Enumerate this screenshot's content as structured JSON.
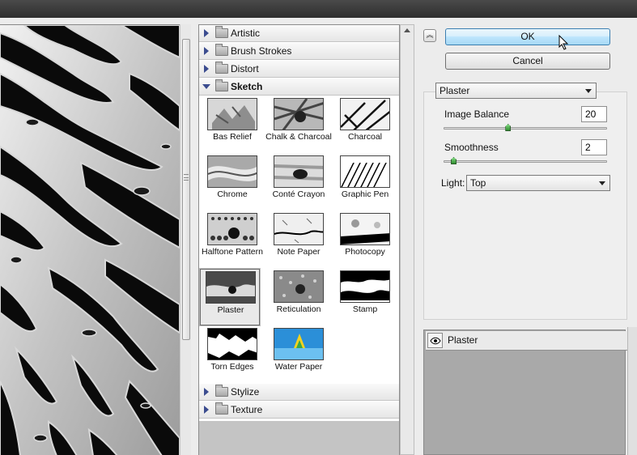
{
  "filter_gallery": {
    "categories_top": [
      {
        "label": "Artistic"
      },
      {
        "label": "Brush Strokes"
      },
      {
        "label": "Distort"
      }
    ],
    "open_category": {
      "label": "Sketch"
    },
    "categories_bottom": [
      {
        "label": "Stylize"
      },
      {
        "label": "Texture"
      }
    ],
    "filters": [
      {
        "label": "Bas Relief"
      },
      {
        "label": "Chalk & Charcoal"
      },
      {
        "label": "Charcoal"
      },
      {
        "label": "Chrome"
      },
      {
        "label": "Conté Crayon"
      },
      {
        "label": "Graphic Pen"
      },
      {
        "label": "Halftone Pattern"
      },
      {
        "label": "Note Paper"
      },
      {
        "label": "Photocopy"
      },
      {
        "label": "Plaster"
      },
      {
        "label": "Reticulation"
      },
      {
        "label": "Stamp"
      },
      {
        "label": "Torn Edges"
      },
      {
        "label": "Water Paper"
      }
    ],
    "selected_filter": "Plaster"
  },
  "buttons": {
    "ok": "OK",
    "cancel": "Cancel",
    "collapse_icon": "double-chevron-up"
  },
  "settings": {
    "filter_select": "Plaster",
    "image_balance": {
      "label": "Image Balance",
      "value": "20",
      "slider_fraction": 0.4
    },
    "smoothness": {
      "label": "Smoothness",
      "value": "2",
      "slider_fraction": 0.067
    },
    "light": {
      "label": "Light:",
      "value": "Top"
    }
  },
  "layers": {
    "items": [
      {
        "name": "Plaster",
        "visible": true
      }
    ]
  },
  "colors": {
    "ok_button": "#bee6fd",
    "selection_border": "#6a6a6a",
    "layers_bg": "#a9a9a9"
  }
}
